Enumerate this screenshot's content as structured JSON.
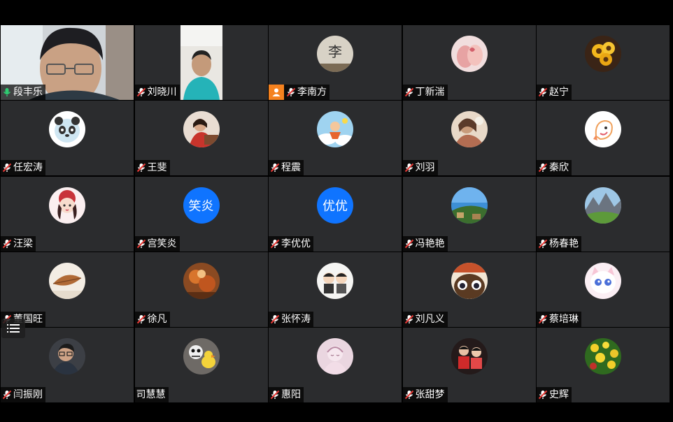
{
  "participants": [
    {
      "name": "段丰乐",
      "mic": "active",
      "media": "video-large",
      "icon": "video-feed"
    },
    {
      "name": "刘晓川",
      "mic": "muted",
      "media": "video-small",
      "icon": "video-feed"
    },
    {
      "name": "李南方",
      "mic": "muted",
      "media": "photo",
      "icon": "calligraphy-avatar",
      "badge": "user-icon"
    },
    {
      "name": "丁新湍",
      "mic": "muted",
      "media": "photo",
      "icon": "hands-avatar"
    },
    {
      "name": "赵宁",
      "mic": "muted",
      "media": "photo",
      "icon": "sunflower-avatar"
    },
    {
      "name": "任宏涛",
      "mic": "muted",
      "media": "photo",
      "icon": "panda-mascot-avatar"
    },
    {
      "name": "王斐",
      "mic": "muted",
      "media": "photo",
      "icon": "girl-photo-avatar"
    },
    {
      "name": "程震",
      "mic": "muted",
      "media": "photo",
      "icon": "cartoon-sky-avatar"
    },
    {
      "name": "刘羽",
      "mic": "muted",
      "media": "photo",
      "icon": "portrait-avatar"
    },
    {
      "name": "秦欣",
      "mic": "muted",
      "media": "photo",
      "icon": "cartoon-creature-avatar"
    },
    {
      "name": "汪梁",
      "mic": "muted",
      "media": "photo",
      "icon": "cartoon-girl-avatar"
    },
    {
      "name": "宫笑炎",
      "mic": "muted",
      "media": "text",
      "initials": "笑炎"
    },
    {
      "name": "李优优",
      "mic": "muted",
      "media": "text",
      "initials": "优优"
    },
    {
      "name": "冯艳艳",
      "mic": "muted",
      "media": "photo",
      "icon": "landscape-avatar"
    },
    {
      "name": "杨春艳",
      "mic": "muted",
      "media": "photo",
      "icon": "mountain-avatar"
    },
    {
      "name": "董国旺",
      "mic": "muted",
      "media": "photo",
      "icon": "leaf-avatar"
    },
    {
      "name": "徐凡",
      "mic": "muted",
      "media": "photo",
      "icon": "autumn-avatar"
    },
    {
      "name": "张怀涛",
      "mic": "muted",
      "media": "photo",
      "icon": "cartoon-kids-avatar"
    },
    {
      "name": "刘凡义",
      "mic": "muted",
      "media": "photo",
      "icon": "cartoon-eyes-avatar"
    },
    {
      "name": "蔡培琳",
      "mic": "muted",
      "media": "photo",
      "icon": "cartoon-cat-avatar"
    },
    {
      "name": "闫振刚",
      "mic": "muted",
      "media": "photo",
      "icon": "man-glasses-avatar"
    },
    {
      "name": "司慧慧",
      "mic": "none",
      "media": "photo",
      "icon": "toys-avatar"
    },
    {
      "name": "惠阳",
      "mic": "muted",
      "media": "photo",
      "icon": "sketch-avatar"
    },
    {
      "name": "张甜梦",
      "mic": "muted",
      "media": "photo",
      "icon": "kids-photo-avatar"
    },
    {
      "name": "史辉",
      "mic": "muted",
      "media": "photo",
      "icon": "flowers-avatar"
    }
  ],
  "menu_icon": "list-menu-icon",
  "colors": {
    "tile_bg": "#2b2c2e",
    "active_border": "#3cb371",
    "mic_active": "#2ecc71",
    "mic_muted": "#e53935",
    "text_avatar": "#0f74ff",
    "badge": "#f5821f"
  }
}
